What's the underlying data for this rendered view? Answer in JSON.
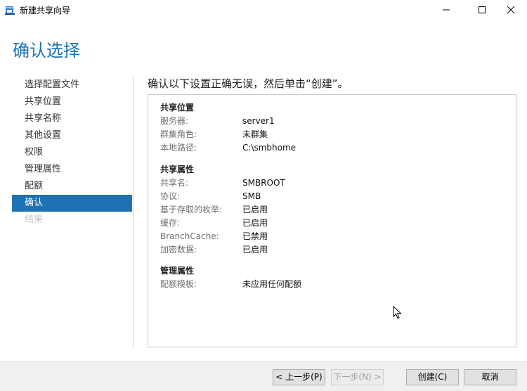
{
  "window": {
    "title": "新建共享向导",
    "icon": "share-wizard-icon",
    "controls": [
      "minimize-icon",
      "maximize-icon",
      "close-icon"
    ]
  },
  "page": {
    "title": "确认选择",
    "instruction": "确认以下设置正确无误，然后单击“创建”。"
  },
  "nav": {
    "items": [
      {
        "label": "选择配置文件",
        "state": "normal"
      },
      {
        "label": "共享位置",
        "state": "normal"
      },
      {
        "label": "共享名称",
        "state": "normal"
      },
      {
        "label": "其他设置",
        "state": "normal"
      },
      {
        "label": "权限",
        "state": "normal"
      },
      {
        "label": "管理属性",
        "state": "normal"
      },
      {
        "label": "配额",
        "state": "normal"
      },
      {
        "label": "确认",
        "state": "active"
      },
      {
        "label": "结果",
        "state": "disabled"
      }
    ]
  },
  "summary": {
    "share_location": {
      "title": "共享位置",
      "rows": [
        {
          "label": "服务器:",
          "value": "server1"
        },
        {
          "label": "群集角色:",
          "value": "未群集"
        },
        {
          "label": "本地路径:",
          "value": "C:\\smbhome"
        }
      ]
    },
    "share_properties": {
      "title": "共享属性",
      "rows": [
        {
          "label": "共享名:",
          "value": "SMBROOT"
        },
        {
          "label": "协议:",
          "value": "SMB"
        },
        {
          "label": "基于存取的枚举:",
          "value": "已启用"
        },
        {
          "label": "缓存:",
          "value": "已启用"
        },
        {
          "label": "BranchCache:",
          "value": "已禁用"
        },
        {
          "label": "加密数据:",
          "value": "已启用"
        }
      ]
    },
    "management_properties": {
      "title": "管理属性",
      "rows": [
        {
          "label": "配额模板:",
          "value": "未应用任何配额"
        }
      ]
    }
  },
  "buttons": {
    "prev": "< 上一步(P)",
    "next": "下一步(N) >",
    "create": "创建(C)",
    "cancel": "取消"
  },
  "colors": {
    "accent": "#1e72b3",
    "label": "#707070",
    "border": "#c8c8c8"
  }
}
